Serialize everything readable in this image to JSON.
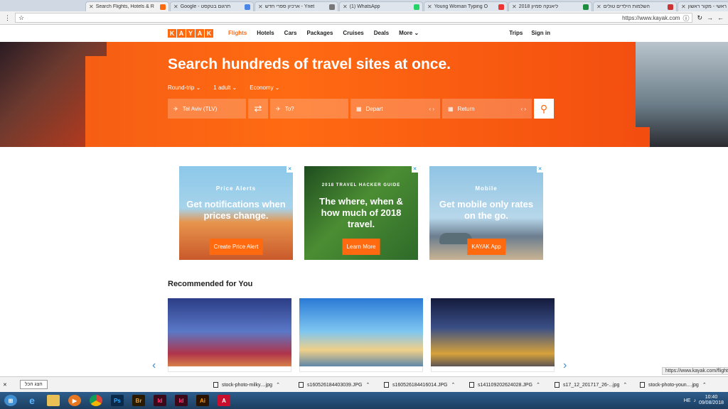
{
  "browser": {
    "tabs": [
      {
        "title": "Search Flights, Hotels & R",
        "fav": "#ff690f",
        "active": true
      },
      {
        "title": "Google - תרגום בטקסט",
        "fav": "#4a86e8"
      },
      {
        "title": "ארכיון ספרי חדש - Ynet",
        "fav": "#777"
      },
      {
        "title": "(1) WhatsApp",
        "fav": "#25d366"
      },
      {
        "title": "Young Woman Typing O",
        "fav": "#e33"
      },
      {
        "title": "ליאנקה סמיון 2018",
        "fav": "#1e8e3e"
      },
      {
        "title": "השלמות הילדים טולים",
        "fav": "#c33"
      },
      {
        "title": "ראשי - מקור ראשון",
        "fav": "#2a6ebb"
      }
    ],
    "url": "https://www.kayak.com"
  },
  "nav": {
    "logo_letters": [
      "K",
      "A",
      "Y",
      "A",
      "K"
    ],
    "links": [
      "Flights",
      "Hotels",
      "Cars",
      "Packages",
      "Cruises",
      "Deals",
      "More ⌄"
    ],
    "right": [
      "Trips",
      "Sign in"
    ]
  },
  "hero": {
    "headline": "Search hundreds of travel sites at once.",
    "options": [
      "Round-trip ⌄",
      "1 adult ⌄",
      "Economy ⌄"
    ],
    "from": "Tel Aviv (TLV)",
    "to": "To?",
    "depart": "Depart",
    "return": "Return",
    "arrows": "‹  ›"
  },
  "ads": [
    {
      "label": "Price Alerts",
      "headline": "Get notifications when prices change.",
      "button": "Create Price Alert"
    },
    {
      "label": "2018 TRAVEL HACKER GUIDE",
      "headline": "The where, when & how much of 2018 travel.",
      "button": "Learn More"
    },
    {
      "label": "Mobile",
      "headline": "Get mobile only rates on the go.",
      "button": "KAYAK App"
    }
  ],
  "recommended": {
    "title": "Recommended for You"
  },
  "statusbar": "https://www.kayak.com/flights",
  "downloads": {
    "show_all": "הצג הכל",
    "files": [
      "stock-photo-milky....jpg",
      "s160526184403039.JPG",
      "s160526184416014.JPG",
      "s141109202624028.JPG",
      "s17_12_201717_26-...jpg",
      "stock-photo-youn....jpg"
    ]
  },
  "taskbar": {
    "apps": [
      "Ps",
      "Br",
      "Id",
      "Id",
      "Ai",
      "A"
    ],
    "lang": "HE",
    "time": "10:40",
    "date": "09/08/2018"
  }
}
